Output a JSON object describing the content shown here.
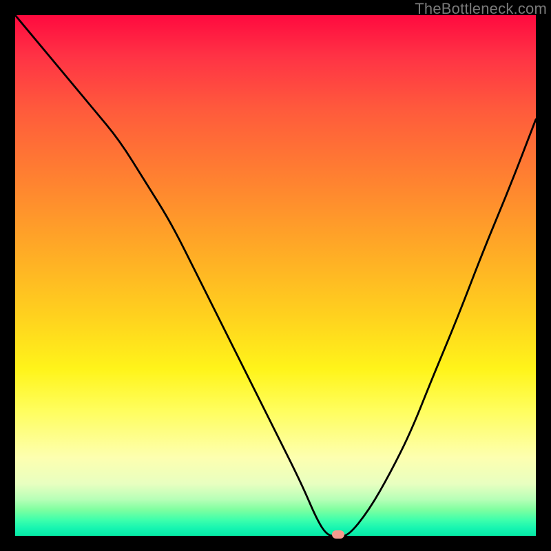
{
  "watermark": "TheBottleneck.com",
  "colors": {
    "curve": "#000000",
    "marker": "#f69a8e",
    "gradient_top": "#ff0a3f",
    "gradient_bottom": "#05e8a5"
  },
  "chart_data": {
    "type": "line",
    "title": "",
    "xlabel": "",
    "ylabel": "",
    "xlim": [
      0,
      100
    ],
    "ylim": [
      0,
      100
    ],
    "grid": false,
    "legend": false,
    "series": [
      {
        "name": "bottleneck-curve",
        "x": [
          0,
          5,
          10,
          15,
          20,
          25,
          30,
          35,
          40,
          45,
          50,
          55,
          58,
          60,
          62,
          64,
          68,
          72,
          76,
          80,
          85,
          90,
          95,
          100
        ],
        "values": [
          100,
          94,
          88,
          82,
          76,
          68,
          60,
          50,
          40,
          30,
          20,
          10,
          3,
          0,
          0,
          0,
          5,
          12,
          20,
          30,
          42,
          55,
          67,
          80
        ]
      }
    ],
    "marker": {
      "x": 62,
      "y": 0
    },
    "background_gradient": {
      "0": "#ff0a3f",
      "50": "#ffd21e",
      "100": "#05e8a5"
    }
  }
}
